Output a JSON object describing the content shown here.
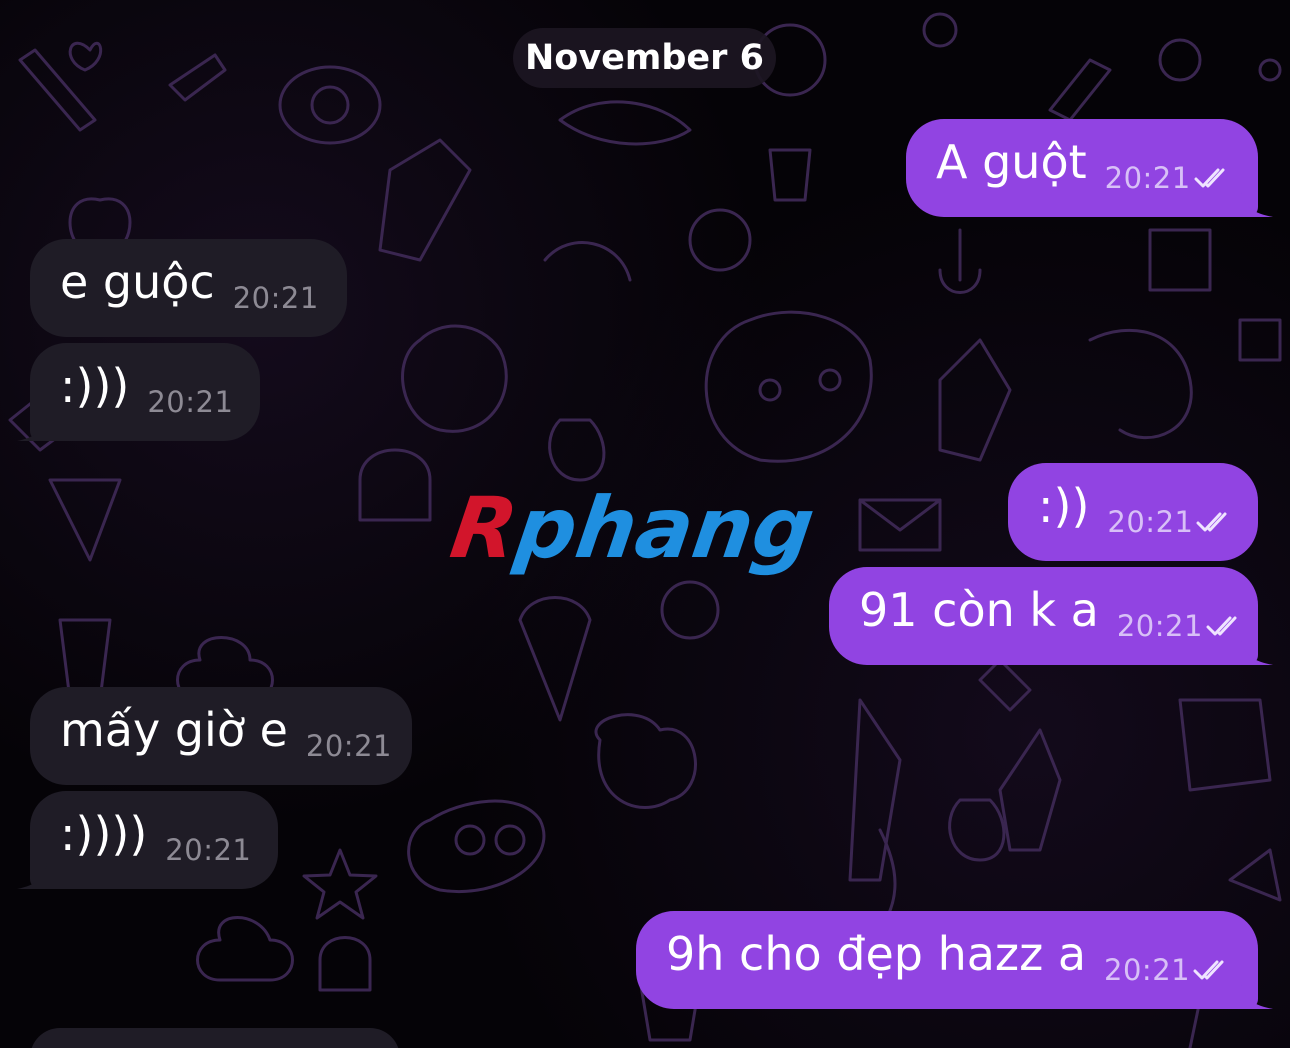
{
  "chat": {
    "date_separator": "November 6",
    "watermark": {
      "first": "R",
      "rest": "phang"
    },
    "messages": [
      {
        "direction": "outgoing",
        "text": "A guột",
        "time": "20:21",
        "status": "read-double-check"
      },
      {
        "direction": "incoming",
        "text": "e guộc",
        "time": "20:21"
      },
      {
        "direction": "incoming",
        "text": ":)))",
        "time": "20:21"
      },
      {
        "direction": "outgoing",
        "text": ":))",
        "time": "20:21",
        "status": "read-double-check"
      },
      {
        "direction": "outgoing",
        "text": "91 còn k a",
        "time": "20:21",
        "status": "read-double-check"
      },
      {
        "direction": "incoming",
        "text": "mấy giờ e",
        "time": "20:21"
      },
      {
        "direction": "incoming",
        "text": ":))))",
        "time": "20:21"
      },
      {
        "direction": "outgoing",
        "text": "9h cho đẹp hazz a",
        "time": "20:21",
        "status": "read-double-check"
      }
    ]
  },
  "colors": {
    "background": "#050307",
    "incoming_bubble": "#1f1c26",
    "outgoing_bubble": "#9144e2",
    "doodle_stroke": "#3a2650"
  },
  "icons": {
    "read_receipt": "double-check-icon",
    "message_tail": "bubble-tail-icon"
  }
}
